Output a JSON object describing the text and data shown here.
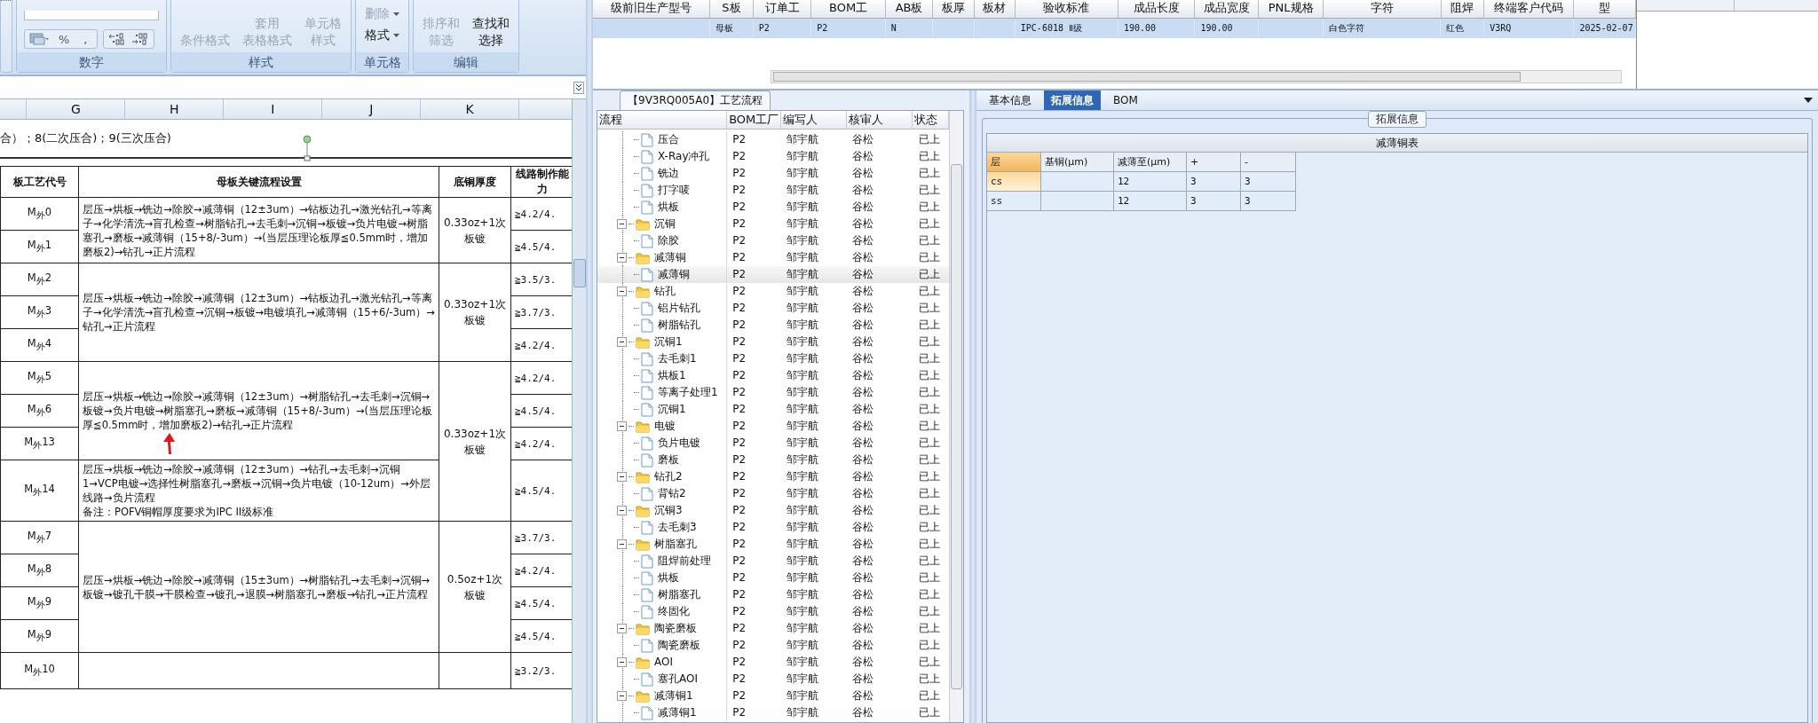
{
  "ribbon": {
    "groups": [
      {
        "kind": "number",
        "label": "数字",
        "symbols": [
          "%",
          ","
        ]
      },
      {
        "kind": "large",
        "label": "样式",
        "buttons": [
          {
            "lines": [
              "条件格式"
            ],
            "disabled": true
          },
          {
            "lines": [
              "套用",
              "表格格式"
            ],
            "disabled": true
          },
          {
            "lines": [
              "单元格",
              "样式"
            ],
            "disabled": true
          }
        ]
      },
      {
        "kind": "small",
        "label": "单元格",
        "buttons": [
          {
            "lines": [
              "删除"
            ],
            "disabled": true
          },
          {
            "lines": [
              "格式"
            ],
            "disabled": false
          }
        ]
      },
      {
        "kind": "large",
        "label": "编辑",
        "buttons": [
          {
            "lines": [
              "排序和",
              "筛选"
            ],
            "disabled": true
          },
          {
            "lines": [
              "查找和",
              "选择"
            ],
            "disabled": false
          }
        ]
      }
    ]
  },
  "sheet": {
    "columns": [
      "G",
      "H",
      "I",
      "J",
      "K"
    ],
    "note": "合）；8(二次压合)；9(三次压合)",
    "headers": [
      "板工艺代号",
      "母板关键流程设置",
      "底铜厚度",
      "线路制作能力"
    ],
    "groups": [
      {
        "copper": "0.33oz+1次板镀",
        "sections": [
          {
            "flow": [
              "层压→烘板→铣边→除胶→减薄铜（12±3um）→钻板边孔→激光钻孔→等离子→化学清洗→盲孔检查→树脂钻孔→去毛刺→沉铜→板镀→负片电镀→树脂塞孔→磨板→减薄铜（15+8/-3um）→(当层压理论板厚≦0.5mm时，增加磨板2)→钻孔→正片流程"
            ],
            "rows": [
              {
                "code": "M$_{外}$0",
                "capability": "≧4.2/4."
              },
              {
                "code": "M$_{外}$1",
                "capability": "≧4.5/4."
              }
            ]
          }
        ]
      },
      {
        "copper": "0.33oz+1次板镀",
        "sections": [
          {
            "flow": [
              "层压→烘板→铣边→除胶→减薄铜（12±3um）→钻板边孔→激光钻孔→等离子→化学清洗→盲孔检查→沉铜→板镀→电镀填孔→减薄铜（15+6/-3um）→钻孔→正片流程"
            ],
            "rows": [
              {
                "code": "M$_{外}$2",
                "capability": "≧3.5/3."
              },
              {
                "code": "M$_{外}$3",
                "capability": "≧3.7/3."
              },
              {
                "code": "M$_{外}$4",
                "capability": "≧4.2/4."
              }
            ]
          }
        ]
      },
      {
        "copper": "0.33oz+1次板镀",
        "sections": [
          {
            "flow": [
              "层压→烘板→铣边→除胶→减薄铜（12±3um）→树脂钻孔→去毛刺→沉铜→板镀→负片电镀→树脂塞孔→磨板→减薄铜（15+8/-3um）→(当层压理论板厚≦0.5mm时，增加磨板2)→钻孔→正片流程"
            ],
            "rows": [
              {
                "code": "M$_{外}$5",
                "capability": "≧4.2/4."
              },
              {
                "code": "M$_{外}$6",
                "capability": "≧4.5/4."
              },
              {
                "code": "M$_{外}$13",
                "capability": "≧4.2/4."
              }
            ]
          },
          {
            "flow": [
              "层压→烘板→铣边→除胶→减薄铜（12±3um）→钻孔→去毛刺→沉铜1→VCP电镀→选择性树脂塞孔→磨板→沉铜→负片电镀（10-12um）→外层线路→负片流程",
              "备注：POFV铜帽厚度要求为IPC II级标准"
            ],
            "rows": [
              {
                "code": "M$_{外}$14",
                "capability": "≧4.5/4."
              }
            ]
          }
        ]
      },
      {
        "copper": "0.5oz+1次板镀",
        "sections": [
          {
            "flow": [
              "层压→烘板→铣边→除胶→减薄铜（15±3um）→树脂钻孔→去毛刺→沉铜→板镀→镀孔干膜→干膜检查→镀孔→退膜→树脂塞孔→磨板→钻孔→正片流程"
            ],
            "rows": [
              {
                "code": "M$_{外}$7",
                "capability": "≧3.7/3."
              },
              {
                "code": "M$_{外}$8",
                "capability": "≧4.2/4."
              },
              {
                "code": "M$_{外}$9",
                "capability": "≧4.5/4."
              },
              {
                "code": "M$_{外}$9",
                "capability": "≧4.5/4."
              }
            ]
          }
        ]
      },
      {
        "sections": [
          {
            "rows": [
              {
                "code": "M$_{外}$10",
                "capability": "≧3.2/3."
              }
            ]
          }
        ]
      }
    ]
  },
  "grid": {
    "columns": [
      "级前旧生产型号",
      "S板",
      "订单工",
      "BOM工",
      "AB板",
      "板厚",
      "板材",
      "验收标准",
      "成品长度",
      "成品宽度",
      "PNL规格",
      "字符",
      "阻焊",
      "终端客户代码",
      "型"
    ],
    "rows": [
      {
        "selected": true,
        "cells": [
          null,
          "母板",
          "P2",
          "P2",
          "N",
          null,
          null,
          "IPC-6018 Ⅱ级",
          "190.00",
          "190.00",
          null,
          "白色字符",
          "红色",
          "V3RQ",
          "2025-02-07"
        ]
      }
    ]
  },
  "tree": {
    "title": "【9V3RQ005A0】工艺流程",
    "columns": [
      "流程",
      "BOM工厂",
      "编写人",
      "核审人",
      "状态"
    ],
    "nodes": [
      {
        "kind": "file",
        "label": "压合",
        "factory": "P2",
        "author": "邹宇航",
        "reviewer": "谷松",
        "status": "已上",
        "selected": false
      },
      {
        "kind": "file",
        "label": "X-Ray冲孔",
        "factory": "P2",
        "author": "邹宇航",
        "reviewer": "谷松",
        "status": "已上",
        "selected": false
      },
      {
        "kind": "file",
        "label": "铣边",
        "factory": "P2",
        "author": "邹宇航",
        "reviewer": "谷松",
        "status": "已上",
        "selected": false
      },
      {
        "kind": "file",
        "label": "打字唛",
        "factory": "P2",
        "author": "邹宇航",
        "reviewer": "谷松",
        "status": "已上",
        "selected": false
      },
      {
        "kind": "file",
        "label": "烘板",
        "factory": "P2",
        "author": "邹宇航",
        "reviewer": "谷松",
        "status": "已上",
        "selected": false
      },
      {
        "kind": "folder",
        "label": "沉铜",
        "factory": "P2",
        "author": "邹宇航",
        "reviewer": "谷松",
        "status": "已上",
        "selected": false,
        "expanded": true,
        "children": [
          {
            "kind": "file",
            "label": "除胶",
            "factory": "P2",
            "author": "邹宇航",
            "reviewer": "谷松",
            "status": "已上",
            "selected": false
          }
        ]
      },
      {
        "kind": "folder",
        "label": "减薄铜",
        "factory": "P2",
        "author": "邹宇航",
        "reviewer": "谷松",
        "status": "已上",
        "selected": false,
        "expanded": true,
        "children": [
          {
            "kind": "file",
            "label": "减薄铜",
            "factory": "P2",
            "author": "邹宇航",
            "reviewer": "谷松",
            "status": "已上",
            "selected": true
          }
        ]
      },
      {
        "kind": "folder",
        "label": "钻孔",
        "factory": "P2",
        "author": "邹宇航",
        "reviewer": "谷松",
        "status": "已上",
        "selected": false,
        "expanded": true,
        "children": [
          {
            "kind": "file",
            "label": "铝片钻孔",
            "factory": "P2",
            "author": "邹宇航",
            "reviewer": "谷松",
            "status": "已上",
            "selected": false
          },
          {
            "kind": "file",
            "label": "树脂钻孔",
            "factory": "P2",
            "author": "邹宇航",
            "reviewer": "谷松",
            "status": "已上",
            "selected": false
          }
        ]
      },
      {
        "kind": "folder",
        "label": "沉铜1",
        "factory": "P2",
        "author": "邹宇航",
        "reviewer": "谷松",
        "status": "已上",
        "selected": false,
        "expanded": true,
        "children": [
          {
            "kind": "file",
            "label": "去毛刺1",
            "factory": "P2",
            "author": "邹宇航",
            "reviewer": "谷松",
            "status": "已上",
            "selected": false
          },
          {
            "kind": "file",
            "label": "烘板1",
            "factory": "P2",
            "author": "邹宇航",
            "reviewer": "谷松",
            "status": "已上",
            "selected": false
          },
          {
            "kind": "file",
            "label": "等离子处理1",
            "factory": "P2",
            "author": "邹宇航",
            "reviewer": "谷松",
            "status": "已上",
            "selected": false
          },
          {
            "kind": "file",
            "label": "沉铜1",
            "factory": "P2",
            "author": "邹宇航",
            "reviewer": "谷松",
            "status": "已上",
            "selected": false
          }
        ]
      },
      {
        "kind": "folder",
        "label": "电镀",
        "factory": "P2",
        "author": "邹宇航",
        "reviewer": "谷松",
        "status": "已上",
        "selected": false,
        "expanded": true,
        "children": [
          {
            "kind": "file",
            "label": "负片电镀",
            "factory": "P2",
            "author": "邹宇航",
            "reviewer": "谷松",
            "status": "已上",
            "selected": false
          },
          {
            "kind": "file",
            "label": "磨板",
            "factory": "P2",
            "author": "邹宇航",
            "reviewer": "谷松",
            "status": "已上",
            "selected": false
          }
        ]
      },
      {
        "kind": "folder",
        "label": "钻孔2",
        "factory": "P2",
        "author": "邹宇航",
        "reviewer": "谷松",
        "status": "已上",
        "selected": false,
        "expanded": true,
        "children": [
          {
            "kind": "file",
            "label": "背钻2",
            "factory": "P2",
            "author": "邹宇航",
            "reviewer": "谷松",
            "status": "已上",
            "selected": false
          }
        ]
      },
      {
        "kind": "folder",
        "label": "沉铜3",
        "factory": "P2",
        "author": "邹宇航",
        "reviewer": "谷松",
        "status": "已上",
        "selected": false,
        "expanded": true,
        "children": [
          {
            "kind": "file",
            "label": "去毛刺3",
            "factory": "P2",
            "author": "邹宇航",
            "reviewer": "谷松",
            "status": "已上",
            "selected": false
          }
        ]
      },
      {
        "kind": "folder",
        "label": "树脂塞孔",
        "factory": "P2",
        "author": "邹宇航",
        "reviewer": "谷松",
        "status": "已上",
        "selected": false,
        "expanded": true,
        "children": [
          {
            "kind": "file",
            "label": "阻焊前处理",
            "factory": "P2",
            "author": "邹宇航",
            "reviewer": "谷松",
            "status": "已上",
            "selected": false
          },
          {
            "kind": "file",
            "label": "烘板",
            "factory": "P2",
            "author": "邹宇航",
            "reviewer": "谷松",
            "status": "已上",
            "selected": false
          },
          {
            "kind": "file",
            "label": "树脂塞孔",
            "factory": "P2",
            "author": "邹宇航",
            "reviewer": "谷松",
            "status": "已上",
            "selected": false
          },
          {
            "kind": "file",
            "label": "终固化",
            "factory": "P2",
            "author": "邹宇航",
            "reviewer": "谷松",
            "status": "已上",
            "selected": false
          }
        ]
      },
      {
        "kind": "folder",
        "label": "陶瓷磨板",
        "factory": "P2",
        "author": "邹宇航",
        "reviewer": "谷松",
        "status": "已上",
        "selected": false,
        "expanded": true,
        "children": [
          {
            "kind": "file",
            "label": "陶瓷磨板",
            "factory": "P2",
            "author": "邹宇航",
            "reviewer": "谷松",
            "status": "已上",
            "selected": false
          }
        ]
      },
      {
        "kind": "folder",
        "label": "AOI",
        "factory": "P2",
        "author": "邹宇航",
        "reviewer": "谷松",
        "status": "已上",
        "selected": false,
        "expanded": true,
        "children": [
          {
            "kind": "file",
            "label": "塞孔AOI",
            "factory": "P2",
            "author": "邹宇航",
            "reviewer": "谷松",
            "status": "已上",
            "selected": false
          }
        ]
      },
      {
        "kind": "folder",
        "label": "减薄铜1",
        "factory": "P2",
        "author": "邹宇航",
        "reviewer": "谷松",
        "status": "已上",
        "selected": false,
        "expanded": true,
        "children": [
          {
            "kind": "file",
            "label": "减薄铜1",
            "factory": "P2",
            "author": "邹宇航",
            "reviewer": "谷松",
            "status": "已上",
            "selected": false
          }
        ]
      }
    ]
  },
  "details": {
    "tabs": [
      {
        "label": "基本信息",
        "selected": false
      },
      {
        "label": "拓展信息",
        "selected": true
      },
      {
        "label": "BOM",
        "selected": false
      }
    ],
    "group_title": "拓展信息",
    "table_title": "减薄铜表",
    "columns": [
      "层",
      "基铜(μm)",
      "减薄至(μm)",
      "+",
      "-"
    ],
    "rows": [
      {
        "layer": "cs",
        "thin_to": "12",
        "plus": "3",
        "minus": "3",
        "selected": true
      },
      {
        "layer": "ss",
        "thin_to": "12",
        "plus": "3",
        "minus": "3",
        "selected": false
      }
    ]
  }
}
